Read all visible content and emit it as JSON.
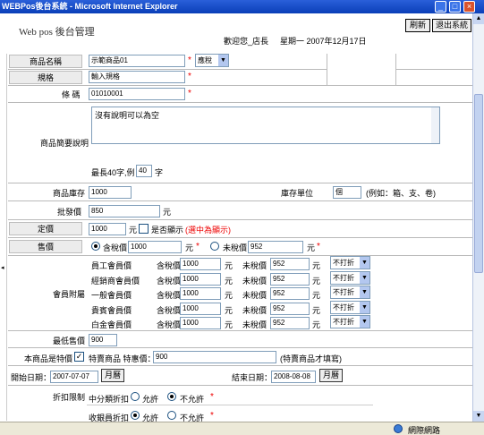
{
  "window": {
    "title": "WEBPos後台系統 - Microsoft Internet Explorer"
  },
  "header": {
    "logo": "Web pos  後台管理",
    "welcome": "歡迎您_店長",
    "date": "星期一 2007年12月17日",
    "refresh_label": "刷新",
    "exit_label": "退出系統"
  },
  "form": {
    "name": {
      "label": "商品名稱",
      "value": "示範商品01",
      "tax_option": "應稅"
    },
    "spec": {
      "label": "規格",
      "value": "輸入規格"
    },
    "barcode": {
      "label": "條 碼",
      "value": "01010001"
    },
    "desc": {
      "label": "商品簡要說明",
      "value": "沒有說明可以為空",
      "maxlen_prefix": "最長40字,例",
      "maxlen_value": "40",
      "maxlen_suffix": "字"
    },
    "stock": {
      "label": "商品庫存",
      "value": "1000"
    },
    "stock_unit": {
      "label": "庫存單位",
      "value": "個",
      "hint": "(例如：箱、支、卷)"
    },
    "wholesale": {
      "label": "批發價",
      "value": "850",
      "unit": "元"
    },
    "list_price": {
      "label": "定價",
      "value": "1000",
      "unit": "元",
      "show_label": "是否顯示",
      "show_hint": "(選中為顯示)"
    },
    "sale_price": {
      "label": "售價",
      "incl_label": "含稅價",
      "incl_value": "1000",
      "incl_unit": "元",
      "excl_label": "未稅價",
      "excl_value": "952",
      "excl_unit": "元"
    },
    "member": {
      "label": "會員附屬",
      "incl_label": "含稅價",
      "excl_label": "未稅價",
      "unit": "元",
      "rows": [
        {
          "name": "員工會員價",
          "incl": "1000",
          "excl": "952",
          "discount": "不打折"
        },
        {
          "name": "經銷商會員價",
          "incl": "1000",
          "excl": "952",
          "discount": "不打折"
        },
        {
          "name": "一般會員價",
          "incl": "1000",
          "excl": "952",
          "discount": "不打折"
        },
        {
          "name": "貴賓會員價",
          "incl": "1000",
          "excl": "952",
          "discount": "不打折"
        },
        {
          "name": "白金會員價",
          "incl": "1000",
          "excl": "952",
          "discount": "不打折"
        }
      ]
    },
    "min_price": {
      "label": "最低售價",
      "value": "900"
    },
    "special": {
      "label": "本商品是特價",
      "price_label": "特賣商品 特惠價：",
      "price_value": "900",
      "hint": "(特賣商品才填寫)"
    },
    "dates": {
      "start_label": "開始日期：",
      "start_value": "2007-07-07",
      "end_label": "結束日期：",
      "end_value": "2008-08-08",
      "month_btn": "月曆"
    },
    "discount_limit": {
      "label": "折扣限制",
      "sub1": "中分類折扣",
      "allow": "允許",
      "deny": "不允許",
      "sub2": "收銀員折扣"
    }
  },
  "status": {
    "zone": "網際網路"
  }
}
